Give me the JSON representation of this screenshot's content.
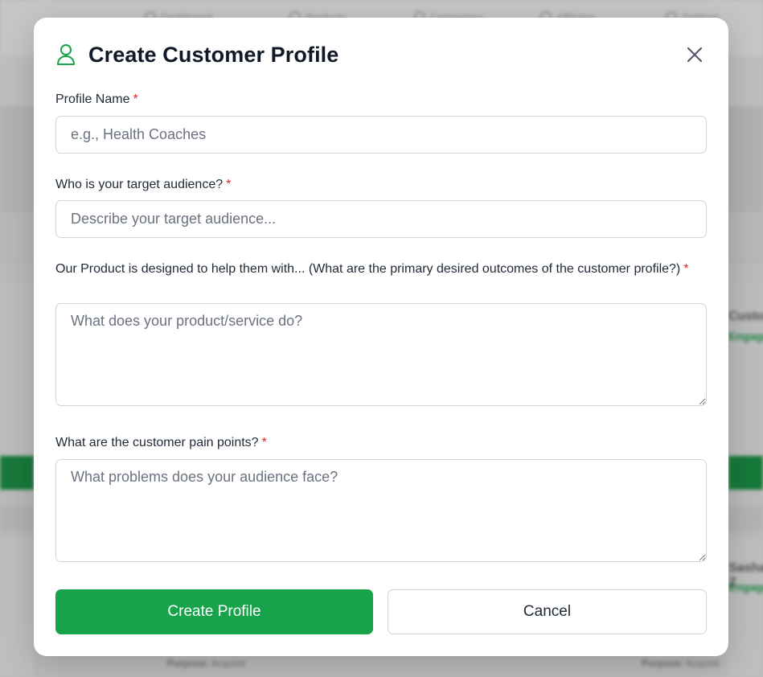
{
  "background": {
    "nav_items": [
      "Dashboard",
      "Products",
      "Campaigns",
      "Affiliates",
      "Settings"
    ],
    "right_card_titles": [
      "Customer",
      "Sasha Z"
    ],
    "right_card_subtitle": "Engaged",
    "card_purpose_label": "Purpose:",
    "card_purpose_value": "Acquisit"
  },
  "modal": {
    "title": "Create Customer Profile",
    "header_icon": "user-icon",
    "close_icon": "close-icon",
    "required_marker": "*",
    "fields": {
      "profile_name": {
        "label": "Profile Name",
        "placeholder": "e.g., Health Coaches",
        "value": ""
      },
      "target_audience": {
        "label": "Who is your target audience?",
        "placeholder": "Describe your target audience...",
        "value": ""
      },
      "product_outcomes": {
        "label": "Our Product is designed to help them with... (What are the primary desired outcomes of the customer profile?)",
        "placeholder": "What does your product/service do?",
        "value": ""
      },
      "pain_points": {
        "label": "What are the customer pain points?",
        "placeholder": "What problems does your audience face?",
        "value": ""
      }
    },
    "buttons": {
      "primary": "Create Profile",
      "secondary": "Cancel"
    }
  },
  "colors": {
    "accent_green": "#18a34a",
    "required_red": "#dc2626",
    "title_text": "#111827"
  }
}
